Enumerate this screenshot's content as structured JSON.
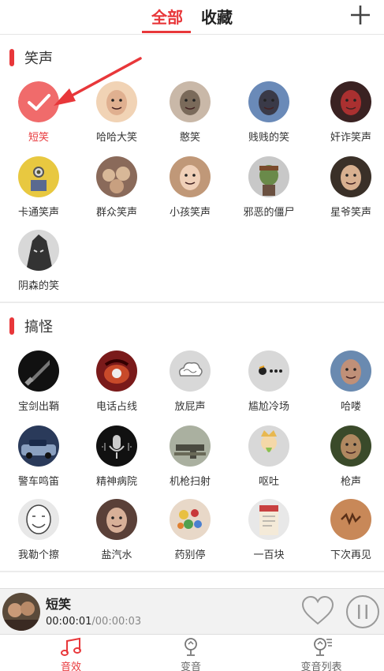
{
  "header": {
    "tabs": [
      "全部",
      "收藏"
    ],
    "add_icon": "plus-icon"
  },
  "sections": [
    {
      "title": "笑声",
      "items": [
        "短笑",
        "哈哈大笑",
        "憨笑",
        "贱贱的笑",
        "奸诈笑声",
        "卡通笑声",
        "群众笑声",
        "小孩笑声",
        "邪恶的僵尸",
        "星爷笑声",
        "阴森的笑"
      ],
      "selected": "短笑"
    },
    {
      "title": "搞怪",
      "items": [
        "宝剑出鞘",
        "电话占线",
        "放屁声",
        "尴尬冷场",
        "哈喽",
        "警车鸣笛",
        "精神病院",
        "机枪扫射",
        "呕吐",
        "枪声",
        "我勒个擦",
        "盐汽水",
        "药别停",
        "一百块",
        "下次再见"
      ]
    }
  ],
  "player": {
    "title": "短笑",
    "current": "00:00:01",
    "duration": "/00:00:03",
    "icons": [
      "heart-icon",
      "pause-icon"
    ]
  },
  "nav": {
    "items": [
      "音效",
      "变音",
      "变音列表"
    ],
    "active": "音效"
  },
  "colors": {
    "accent": "#e8373a"
  }
}
